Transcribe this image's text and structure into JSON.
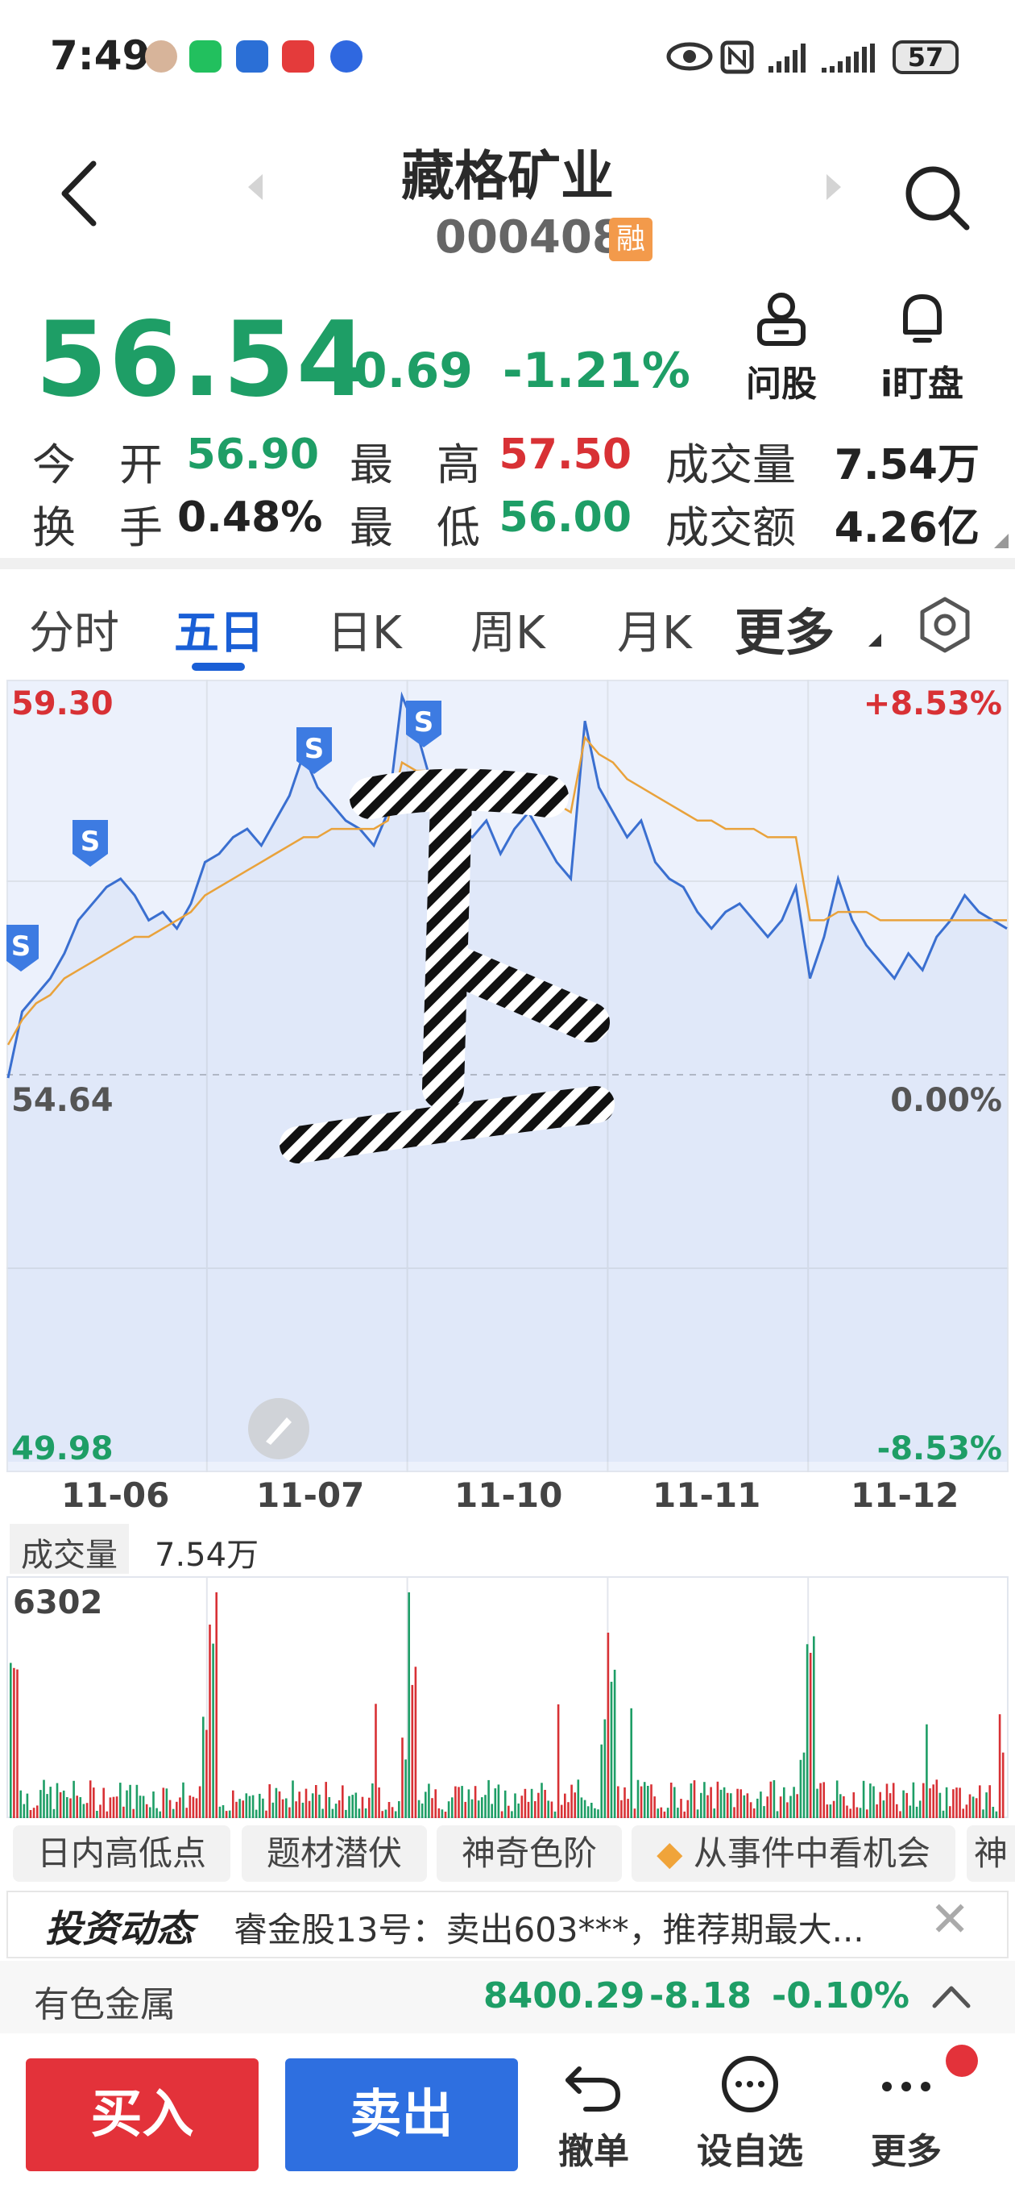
{
  "status_bar": {
    "time": "7:49",
    "battery": "57",
    "app_icons": [
      "avatar-icon",
      "wechat-icon",
      "app-icon",
      "red-app-icon",
      "blue-app-icon"
    ],
    "system_icons": [
      "eye-icon",
      "nfc-icon",
      "signal-icon",
      "signal-icon"
    ]
  },
  "header": {
    "stock_name": "藏格矿业",
    "stock_code": "000408",
    "margin_badge": "融"
  },
  "quote": {
    "price": "56.54",
    "change": "-0.69",
    "change_pct": "-1.21%",
    "rows": [
      [
        {
          "label": "今　开",
          "value": "56.90",
          "color": "#1e9e66"
        },
        {
          "label": "最　高",
          "value": "57.50",
          "color": "#d83135"
        },
        {
          "label": "成交量",
          "value": "7.54万",
          "color": "#222222"
        }
      ],
      [
        {
          "label": "换　手",
          "value": "0.48%",
          "color": "#222222"
        },
        {
          "label": "最　低",
          "value": "56.00",
          "color": "#1e9e66"
        },
        {
          "label": "成交额",
          "value": "4.26亿",
          "color": "#222222"
        }
      ]
    ],
    "tools": {
      "ask": "问股",
      "watch": "i盯盘"
    }
  },
  "tabs": {
    "items": [
      "分时",
      "五日",
      "日K",
      "周K",
      "月K",
      "更多"
    ],
    "active": "五日"
  },
  "chart_data": {
    "type": "line",
    "x": [
      "11-06",
      "11-07",
      "11-10",
      "11-11",
      "11-12"
    ],
    "price_max": "59.30",
    "price_mid": "54.64",
    "price_min": "49.98",
    "pct_max": "+8.53%",
    "pct_mid": "0.00%",
    "pct_min": "-8.53%",
    "ylim": [
      49.98,
      59.3
    ],
    "series": [
      {
        "color": "#3a6fd0",
        "values": [
          54.6,
          55.4,
          55.6,
          55.8,
          56.1,
          56.5,
          56.7,
          56.9,
          57.0,
          56.8,
          56.5,
          56.6,
          56.4,
          56.7,
          57.2,
          57.3,
          57.5,
          57.6,
          57.4,
          57.7,
          58.0,
          58.5,
          58.1,
          57.9,
          57.7,
          57.6,
          57.4,
          57.8,
          59.2,
          58.8,
          58.2,
          58.0,
          57.6,
          57.5,
          57.7,
          57.3,
          57.6,
          57.8,
          57.5,
          57.2,
          57.0,
          58.9,
          58.1,
          57.8,
          57.5,
          57.7,
          57.2,
          57.0,
          56.9,
          56.6,
          56.4,
          56.6,
          56.7,
          56.5,
          56.3,
          56.5,
          56.9,
          55.8,
          56.3,
          57.0,
          56.5,
          56.2,
          56.0,
          55.8,
          56.1,
          55.9,
          56.3,
          56.5,
          56.8,
          56.6,
          56.5,
          56.4
        ]
      },
      {
        "color": "#e9a23b",
        "values": [
          55.0,
          55.3,
          55.5,
          55.6,
          55.8,
          55.9,
          56.0,
          56.1,
          56.2,
          56.3,
          56.3,
          56.4,
          56.5,
          56.6,
          56.8,
          56.9,
          57.0,
          57.1,
          57.2,
          57.3,
          57.4,
          57.5,
          57.5,
          57.6,
          57.6,
          57.6,
          57.6,
          57.7,
          58.4,
          58.3,
          58.3,
          58.2,
          58.2,
          58.1,
          58.0,
          58.0,
          57.9,
          57.9,
          57.9,
          57.9,
          57.8,
          58.7,
          58.5,
          58.4,
          58.2,
          58.1,
          58.0,
          57.9,
          57.8,
          57.7,
          57.7,
          57.6,
          57.6,
          57.6,
          57.5,
          57.5,
          57.5,
          56.5,
          56.5,
          56.6,
          56.6,
          56.6,
          56.5,
          56.5,
          56.5,
          56.5,
          56.5,
          56.5,
          56.5,
          56.5,
          56.5,
          56.5
        ]
      }
    ],
    "markers": [
      "S",
      "S",
      "S",
      "S"
    ]
  },
  "volume": {
    "label": "成交量",
    "value": "7.54万",
    "max": "6302"
  },
  "chips": [
    "日内高低点",
    "题材潜伏",
    "神奇色阶",
    "从事件中看机会",
    "神"
  ],
  "news": {
    "tag": "投资动态",
    "text": "睿金股13号：卖出603***，推荐期最大...",
    "close": "✕"
  },
  "sector": {
    "name": "有色金属",
    "index": "8400.29",
    "change": "-8.18",
    "pct": "-0.10%"
  },
  "bottom": {
    "buy": "买入",
    "sell": "卖出",
    "cancel": "撤单",
    "watchlist": "设自选",
    "more": "更多"
  },
  "colors": {
    "up": "#d83135",
    "down": "#1e9e66",
    "accent": "#1a5fd6",
    "price_line": "#3a6fd0",
    "avg_line": "#e9a23b"
  }
}
